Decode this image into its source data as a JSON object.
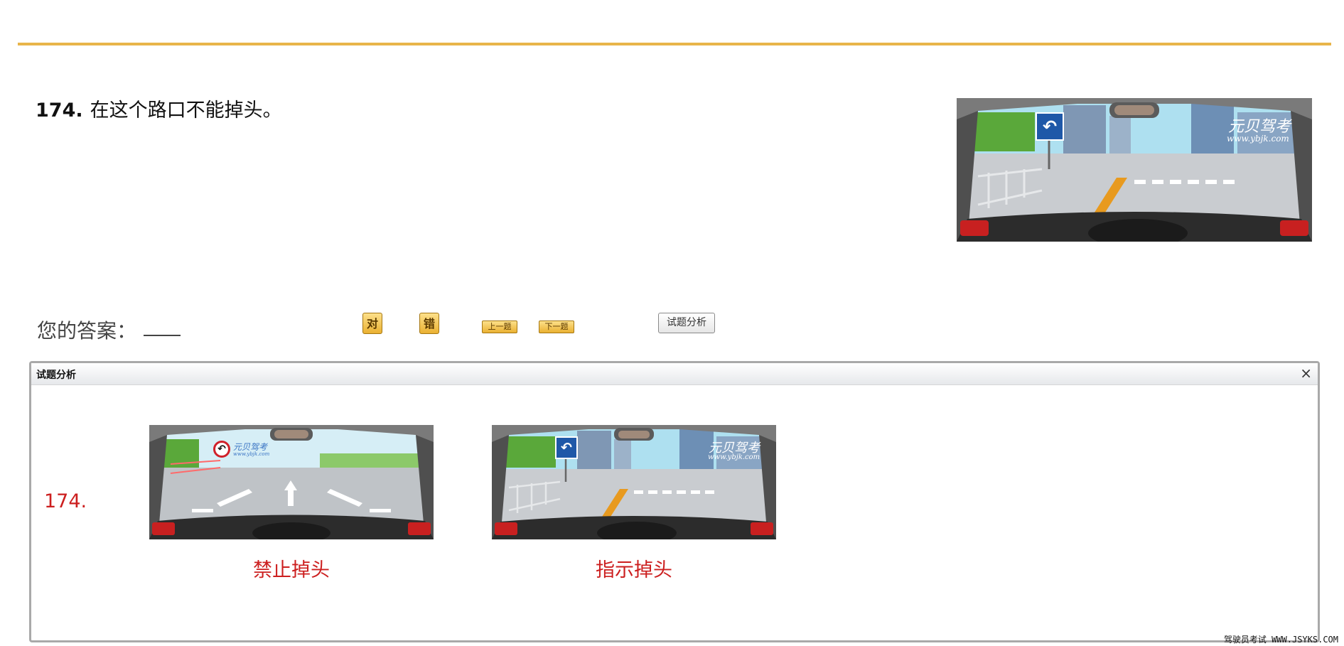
{
  "question": {
    "number": "174.",
    "text": "在这个路口不能掉头。"
  },
  "answer": {
    "label": "您的答案："
  },
  "buttons": {
    "correct": "对",
    "wrong": "错",
    "prev": "上一题",
    "next": "下一题",
    "analysis": "试题分析"
  },
  "scene_texts": {
    "brand": "元贝驾考",
    "url": "www.ybjk.com"
  },
  "analysis_panel": {
    "title": "试题分析",
    "close": "×",
    "number": "174.",
    "captions": [
      "禁止掉头",
      "指示掉头"
    ]
  },
  "watermark": "驾驶员考试 WWW.JSYKS.COM",
  "colors": {
    "rule": "#e8b54a",
    "caption": "#cc1f1f",
    "sign_blue": "#1f58a8",
    "no_uturn_red": "#d0202a"
  },
  "icons": [
    "u-turn-sign-icon",
    "no-u-turn-sign-icon",
    "close-icon"
  ]
}
